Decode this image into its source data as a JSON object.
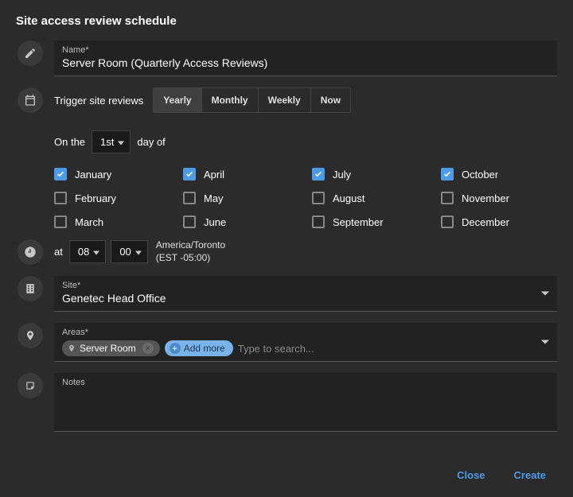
{
  "title": "Site access review schedule",
  "name_field": {
    "label": "Name*",
    "value": "Server Room (Quarterly Access Reviews)"
  },
  "trigger": {
    "label": "Trigger site reviews",
    "options": [
      "Yearly",
      "Monthly",
      "Weekly",
      "Now"
    ],
    "selected": "Yearly"
  },
  "schedule": {
    "prefix": "On the",
    "day": "1st",
    "suffix": "day of",
    "months": [
      {
        "name": "January",
        "checked": true
      },
      {
        "name": "April",
        "checked": true
      },
      {
        "name": "July",
        "checked": true
      },
      {
        "name": "October",
        "checked": true
      },
      {
        "name": "February",
        "checked": false
      },
      {
        "name": "May",
        "checked": false
      },
      {
        "name": "August",
        "checked": false
      },
      {
        "name": "November",
        "checked": false
      },
      {
        "name": "March",
        "checked": false
      },
      {
        "name": "June",
        "checked": false
      },
      {
        "name": "September",
        "checked": false
      },
      {
        "name": "December",
        "checked": false
      }
    ]
  },
  "time": {
    "label": "at",
    "hour": "08",
    "minute": "00",
    "tz_line1": "America/Toronto",
    "tz_line2": "(EST -05:00)"
  },
  "site": {
    "label": "Site*",
    "value": "Genetec Head Office"
  },
  "areas": {
    "label": "Areas*",
    "chips": [
      "Server Room"
    ],
    "add_more": "Add more",
    "placeholder": "Type to search..."
  },
  "notes": {
    "label": "Notes",
    "value": ""
  },
  "footer": {
    "close": "Close",
    "create": "Create"
  }
}
